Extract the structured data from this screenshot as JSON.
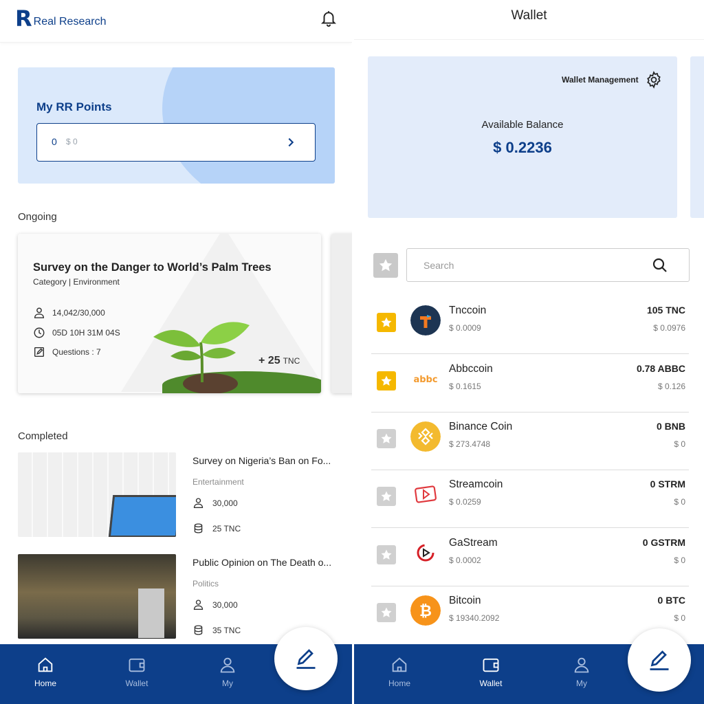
{
  "home": {
    "brand": "Real Research",
    "points": {
      "title": "My RR Points",
      "value": "0",
      "usd": "$ 0"
    },
    "ongoing_label": "Ongoing",
    "ongoing_survey": {
      "title": "Survey on the Danger to World’s Palm Trees",
      "category": "Category | Environment",
      "participants": "14,042/30,000",
      "time_left": "05D 10H 31M 04S",
      "questions": "Questions : 7",
      "reward_amount": "+ 25",
      "reward_unit": "TNC"
    },
    "completed_label": "Completed",
    "completed": [
      {
        "title": "Survey on Nigeria’s Ban on Fo...",
        "category": "Entertainment",
        "participants": "30,000",
        "reward": "25 TNC"
      },
      {
        "title": "Public Opinion on The Death o...",
        "category": "Politics",
        "participants": "30,000",
        "reward": "35 TNC"
      }
    ],
    "nav": {
      "home": "Home",
      "wallet": "Wallet",
      "my": "My"
    }
  },
  "wallet": {
    "title": "Wallet",
    "management": "Wallet Management",
    "available_label": "Available Balance",
    "available_value": "$ 0.2236",
    "search_placeholder": "Search",
    "coins": [
      {
        "name": "Tnccoin",
        "price": "$ 0.0009",
        "amount": "105 TNC",
        "value": "$ 0.0976",
        "favorite": true,
        "color": "#1d3553"
      },
      {
        "name": "Abbccoin",
        "price": "$ 0.1615",
        "amount": "0.78 ABBC",
        "value": "$ 0.126",
        "favorite": true,
        "color": "#f39a2e"
      },
      {
        "name": "Binance Coin",
        "price": "$ 273.4748",
        "amount": "0 BNB",
        "value": "$ 0",
        "favorite": false,
        "color": "#f3ba2f"
      },
      {
        "name": "Streamcoin",
        "price": "$ 0.0259",
        "amount": "0 STRM",
        "value": "$ 0",
        "favorite": false,
        "color": "#e0393e"
      },
      {
        "name": "GaStream",
        "price": "$ 0.0002",
        "amount": "0 GSTRM",
        "value": "$ 0",
        "favorite": false,
        "color": "#d62027"
      },
      {
        "name": "Bitcoin",
        "price": "$ 19340.2092",
        "amount": "0 BTC",
        "value": "$ 0",
        "favorite": false,
        "color": "#f7931a"
      }
    ],
    "nav": {
      "home": "Home",
      "wallet": "Wallet",
      "my": "My"
    }
  },
  "colors": {
    "brand": "#0d3f8a",
    "favorite": "#f5b800"
  }
}
